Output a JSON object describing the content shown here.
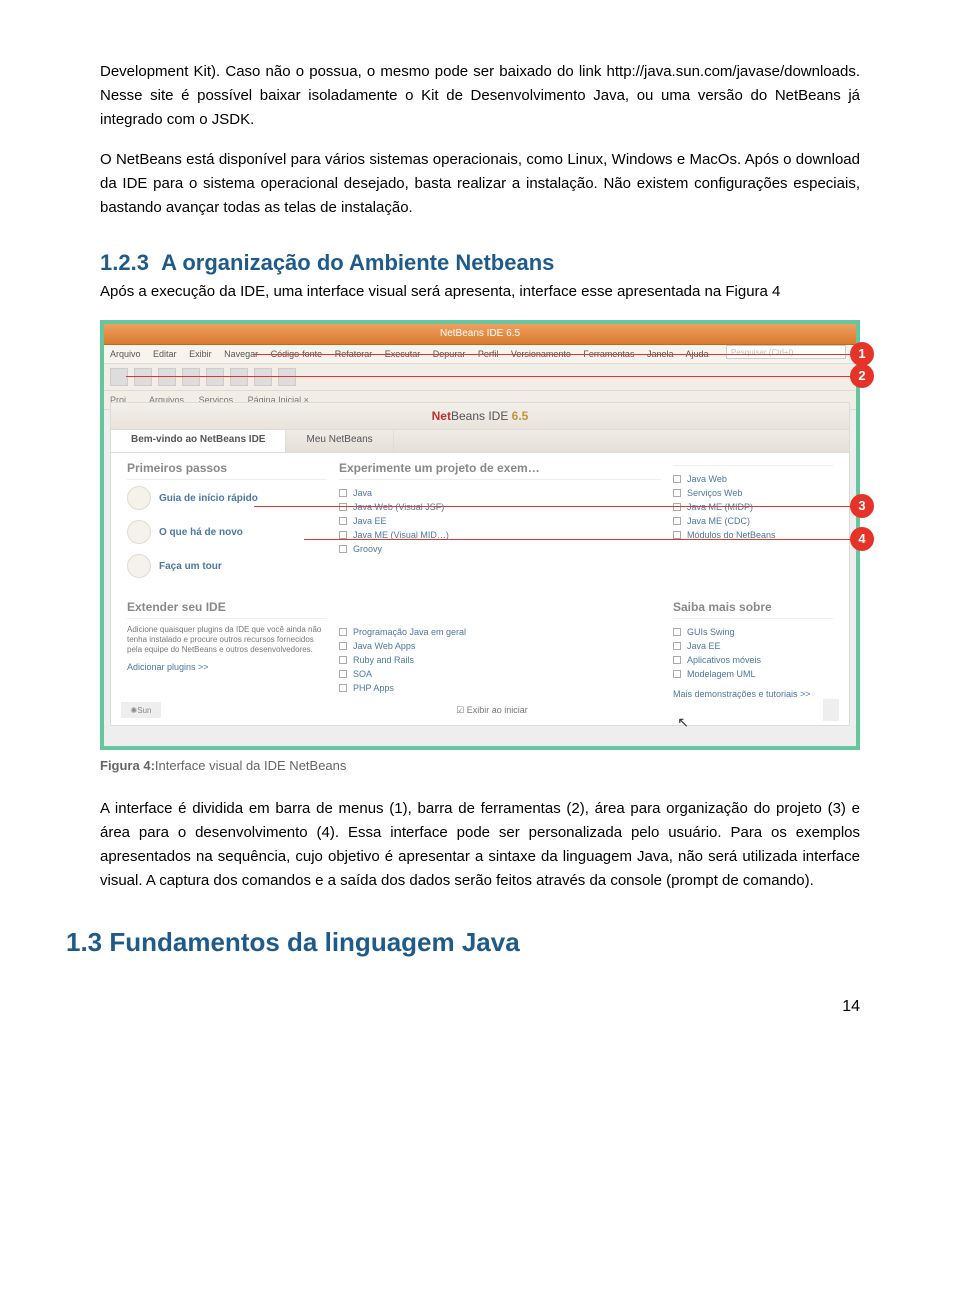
{
  "para1": "Development Kit). Caso não o possua, o mesmo pode ser baixado do link http://java.sun.com/javase/downloads. Nesse site é possível baixar isoladamente o Kit de Desenvolvimento Java, ou uma versão do NetBeans já integrado com o JSDK.",
  "para2": "O NetBeans está disponível para vários sistemas operacionais, como Linux, Windows e MacOs. Após o download da IDE para o sistema operacional desejado, basta realizar a instalação. Não existem configurações especiais, bastando avançar todas as telas de instalação.",
  "section_num": "1.2.3",
  "section_title": "A organização do Ambiente Netbeans",
  "para3": "Após a execução da IDE, uma interface visual será apresenta, interface esse apresentada na Figura 4",
  "fig_label": "Figura 4:",
  "fig_caption": "Interface visual da IDE NetBeans",
  "para4": "A interface é dividida em barra de menus (1), barra de ferramentas (2), área para organização do projeto (3) e área para o desenvolvimento (4). Essa interface pode ser personalizada pelo usuário. Para os exemplos apresentados na sequência, cujo objetivo é apresentar a sintaxe da linguagem Java, não será utilizada interface visual. A captura dos comandos e a saída dos dados serão feitos através da console (prompt de comando).",
  "chapter": "1.3  Fundamentos da linguagem Java",
  "page_number": "14",
  "shot": {
    "window_title": "NetBeans IDE 6.5",
    "menubar": [
      "Arquivo",
      "Editar",
      "Exibir",
      "Navegar",
      "Código-fonte",
      "Refatorar",
      "Executar",
      "Depurar",
      "Perfil",
      "Versionamento",
      "Ferramentas",
      "Janela",
      "Ajuda"
    ],
    "search_ph": "Pesquisar (Ctrl+I)",
    "tabs": [
      "Proj…",
      "Arquivos",
      "Serviços",
      "Página Inicial ×"
    ],
    "logo_text": "NetBeans IDE",
    "logo_ver": "6.5",
    "welcome_tabs": [
      "Bem-vindo ao NetBeans IDE",
      "Meu NetBeans"
    ],
    "col_left_head": "Primeiros passos",
    "col_mid_head": "Experimente um projeto de exem…",
    "col_right_head": "",
    "left_items": [
      "Guia de início rápido",
      "O que há de novo",
      "Faça um tour"
    ],
    "mid_items": [
      "Java",
      "Java Web (Visual JSF)",
      "Java EE",
      "Java ME (Visual MID…)",
      "Groovy"
    ],
    "right_items": [
      "Java Web",
      "Serviços Web",
      "Java ME (MIDP)",
      "Java ME (CDC)",
      "Módulos do NetBeans"
    ],
    "ext_head": "Extender seu IDE",
    "ext_desc": "Adicione quaisquer plugins da IDE que você ainda não tenha instalado e procure outros recursos fornecidos pela equipe do NetBeans e outros desenvolvedores.",
    "ext_link": "Adicionar plugins >>",
    "more_head": "Saiba mais sobre",
    "more_mid": [
      "Programação Java em geral",
      "Java Web Apps",
      "Ruby and Rails",
      "SOA",
      "PHP Apps"
    ],
    "more_right": [
      "GUIs Swing",
      "Java EE",
      "Aplicativos móveis",
      "Modelagem UML"
    ],
    "more_link": "Mais demonstrações e tutoriais >>",
    "footer_chk": "Exibir ao iniciar",
    "badges": [
      "1",
      "2",
      "3",
      "4"
    ]
  }
}
